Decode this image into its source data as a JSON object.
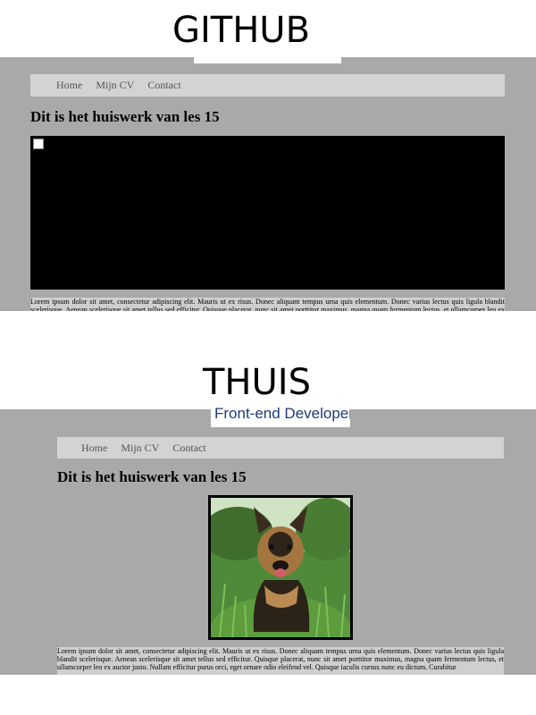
{
  "captions": {
    "top": "GITHUB",
    "bottom": "THUIS"
  },
  "logo": {
    "text": "Front-end Developer"
  },
  "nav": [
    "Home",
    "Mijn CV",
    "Contact"
  ],
  "heading": "Dit is het huiswerk van les 15",
  "lorem": "Lorem ipsum dolor sit amet, consectetur adipiscing elit. Mauris ut ex risus. Donec aliquam tempus urna quis elementum. Donec varius lectus quis ligula blandit scelerisque. Aenean scelerisque sit amet tellus sed efficitur. Quisque placerat, nunc sit amet porttitor maximus, magna quam fermentum lectus, et ullamcorper leo ex auctor justo. Nullam efficitur purus orci, eget ornare odio eleifend vel. Quisque iaculis cursus nunc eu dictum. Curabitur",
  "colors": {
    "panel": "#a9a9a9",
    "nav": "#d3d3d3",
    "text_area": "#cfcfcf",
    "logo_text": "#1e3a7a"
  },
  "images": {
    "top": "broken-image",
    "bottom": "german-shepherd-dog-photo"
  }
}
